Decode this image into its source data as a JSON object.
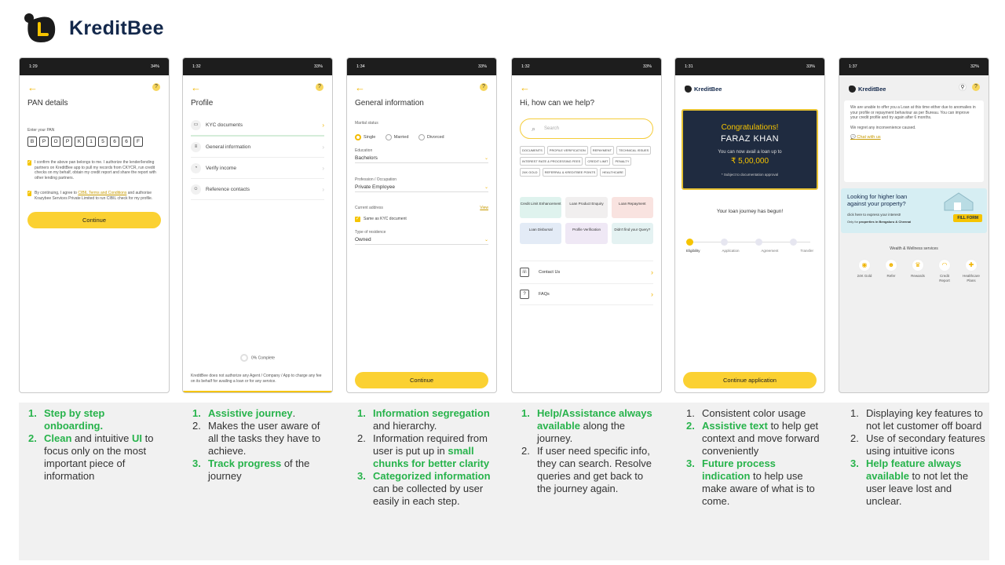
{
  "brand": {
    "name": "KreditBee"
  },
  "status_times": [
    "1:29",
    "1:32",
    "1:34",
    "1:32",
    "1:31",
    "1:37"
  ],
  "status_battery": [
    "34%",
    "33%",
    "33%",
    "33%",
    "33%",
    "32%"
  ],
  "s1": {
    "title": "PAN details",
    "label": "Enter your PAN",
    "pan": [
      "B",
      "P",
      "O",
      "P",
      "K",
      "1",
      "5",
      "6",
      "6",
      "F"
    ],
    "consent1": "I confirm the above pan belongs to me. I authorize the lender/lending partners on KreditBee app to pull my records from CKYCR, run credit checks on my behalf, obtain my credit report and share the report with other lending partners.",
    "consent2_a": "By continuing, I agree to",
    "consent2_link": "CIBIL Terms and Conditions",
    "consent2_b": "and authorise Krazybee Services Private Limited to run CIBIL check for my profile.",
    "button": "Continue"
  },
  "s2": {
    "title": "Profile",
    "items": [
      {
        "label": "KYC documents"
      },
      {
        "label": "General information"
      },
      {
        "label": "Verify income"
      },
      {
        "label": "Reference contacts"
      }
    ],
    "progress": "0% Complete",
    "progress_value": 0,
    "footer": "KreditBee does not authorize any Agent / Company / App to charge any fee on its behalf for availing a loan or for any service."
  },
  "s3": {
    "title": "General information",
    "marital_label": "Marital status",
    "marital_options": [
      "Single",
      "Married",
      "Divorced"
    ],
    "marital_selected": "Single",
    "education_label": "Education",
    "education_value": "Bachelors",
    "profession_label": "Profession / Occupation",
    "profession_value": "Private Employee",
    "address_label": "Current address",
    "address_link": "View",
    "same_as_kyc": "Same as KYC document",
    "residence_label": "Type of residence",
    "residence_value": "Owned",
    "button": "Continue"
  },
  "s4": {
    "title": "Hi, how can we help?",
    "search_placeholder": "Search",
    "chips": [
      "DOCUMENTS",
      "PROFILE VERIFICATION",
      "REPAYMENT",
      "TECHNICAL ISSUES",
      "INTEREST RATE & PROCESSING FEES",
      "CREDIT LIMIT",
      "PENALTY",
      "24K GOLD",
      "REFERRAL & KREDITBEE POINTS",
      "HEALTHCARE"
    ],
    "tiles": [
      {
        "label": "Credit Limit Enhancement",
        "color": "#dff3ee"
      },
      {
        "label": "Loan Product Enquiry",
        "color": "#f1efef"
      },
      {
        "label": "Loan Repayment",
        "color": "#f9e3e0"
      },
      {
        "label": "Loan Disbursal",
        "color": "#e3ebf6"
      },
      {
        "label": "Profile Verification",
        "color": "#efe8f5"
      },
      {
        "label": "Didn't find your Query?",
        "color": "#e4f2f2"
      }
    ],
    "links": [
      {
        "label": "Contact Us"
      },
      {
        "label": "FAQs"
      }
    ]
  },
  "s5": {
    "brand": "KreditBee",
    "congrats": "Congratulations!",
    "name": "FARAZ KHAN",
    "avail_text": "You can now avail a loan up to",
    "amount": "₹ 5,00,000",
    "note": "* Subject to documentation approval",
    "journey": "Your loan journey has begun!",
    "steps": [
      "Eligibility",
      "Application",
      "Agreement",
      "Transfer"
    ],
    "current_step": 1,
    "button": "Continue application"
  },
  "s6": {
    "brand": "KreditBee",
    "message": "We are unable to offer you a Loan at this time either due to anomalies in your profile or repayment behaviour as per Bureau. You can improve your credit profile and try again after 6 months.",
    "regret": "We regret any inconvenience caused.",
    "chat": "Chat with us",
    "banner_title": "Looking for higher loan against your property?",
    "banner_sub": "click here to express your interest!",
    "banner_only_a": "Only for",
    "banner_only_b": "properties",
    "banner_only_c": "in Bengaluru & Chennai",
    "banner_btn": "FILL FORM",
    "wellness_title": "Wealth & Wellness services",
    "wellness": [
      {
        "label": "24K Gold",
        "icon": "gold-icon"
      },
      {
        "label": "Refer",
        "icon": "refer-icon"
      },
      {
        "label": "Rewards",
        "icon": "rewards-icon"
      },
      {
        "label": "Credit Report",
        "icon": "credit-report-icon"
      },
      {
        "label": "Healthcare Plans",
        "icon": "healthcare-icon"
      }
    ]
  },
  "notes": {
    "c1": {
      "i1": {
        "n": "1.",
        "g": "Step by step onboarding."
      },
      "i2": {
        "n": "2.",
        "g1": "Clean",
        "t1": " and intuitive ",
        "g2": "UI",
        "t2": " to focus only on the most important piece of information"
      }
    },
    "c2": {
      "i1": {
        "n": "1.",
        "g": "Assistive journey",
        "t": "."
      },
      "i2": {
        "n": "2.",
        "t": "Makes the user aware of all the tasks they have to achieve."
      },
      "i3": {
        "n": "3.",
        "g": "Track progress",
        "t": " of the journey"
      }
    },
    "c3": {
      "i1": {
        "n": "1.",
        "g": "Information segregation",
        "t": " and hierarchy."
      },
      "i2": {
        "n": "2.",
        "t": "Information required from user is put up in ",
        "g": "small chunks for better clarity"
      },
      "i3": {
        "n": "3.",
        "g": "Categorized information",
        "t": " can be collected by user easily in each step."
      }
    },
    "c4": {
      "i1": {
        "n": "1.",
        "g": "Help/Assistance always available",
        "t": " along the journey."
      },
      "i2": {
        "n": "2.",
        "t": "If user need specific info, they can search. Resolve queries and get back to the journey again."
      }
    },
    "c5": {
      "i1": {
        "n": "1.",
        "t": "Consistent color usage"
      },
      "i2": {
        "n": "2.",
        "g": "Assistive text",
        "t": " to help get context and move forward conveniently"
      },
      "i3": {
        "n": "3.",
        "g": "Future process indication",
        "t": " to help use make aware of what is to come."
      }
    },
    "c6": {
      "i1": {
        "n": "1.",
        "t": "Displaying key features to not let customer off board"
      },
      "i2": {
        "n": "2.",
        "t": "Use of secondary features using intuitive icons"
      },
      "i3": {
        "n": "3.",
        "g": "Help feature always available",
        "t": " to not let the user leave lost and unclear."
      }
    }
  },
  "colors": {
    "accent": "#fbd132",
    "green": "#27b34b",
    "navy": "#13284b"
  }
}
